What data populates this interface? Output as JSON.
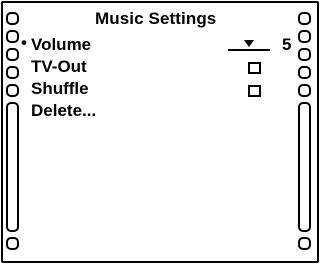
{
  "screen": {
    "title": "Music Settings",
    "selection_marker": "•",
    "menu": [
      {
        "label": "Volume"
      },
      {
        "label": "TV-Out"
      },
      {
        "label": "Shuffle"
      },
      {
        "label": "Delete..."
      }
    ],
    "volume": {
      "value": "5"
    },
    "tv_out": {
      "checked": false
    },
    "shuffle": {
      "checked": false
    }
  }
}
